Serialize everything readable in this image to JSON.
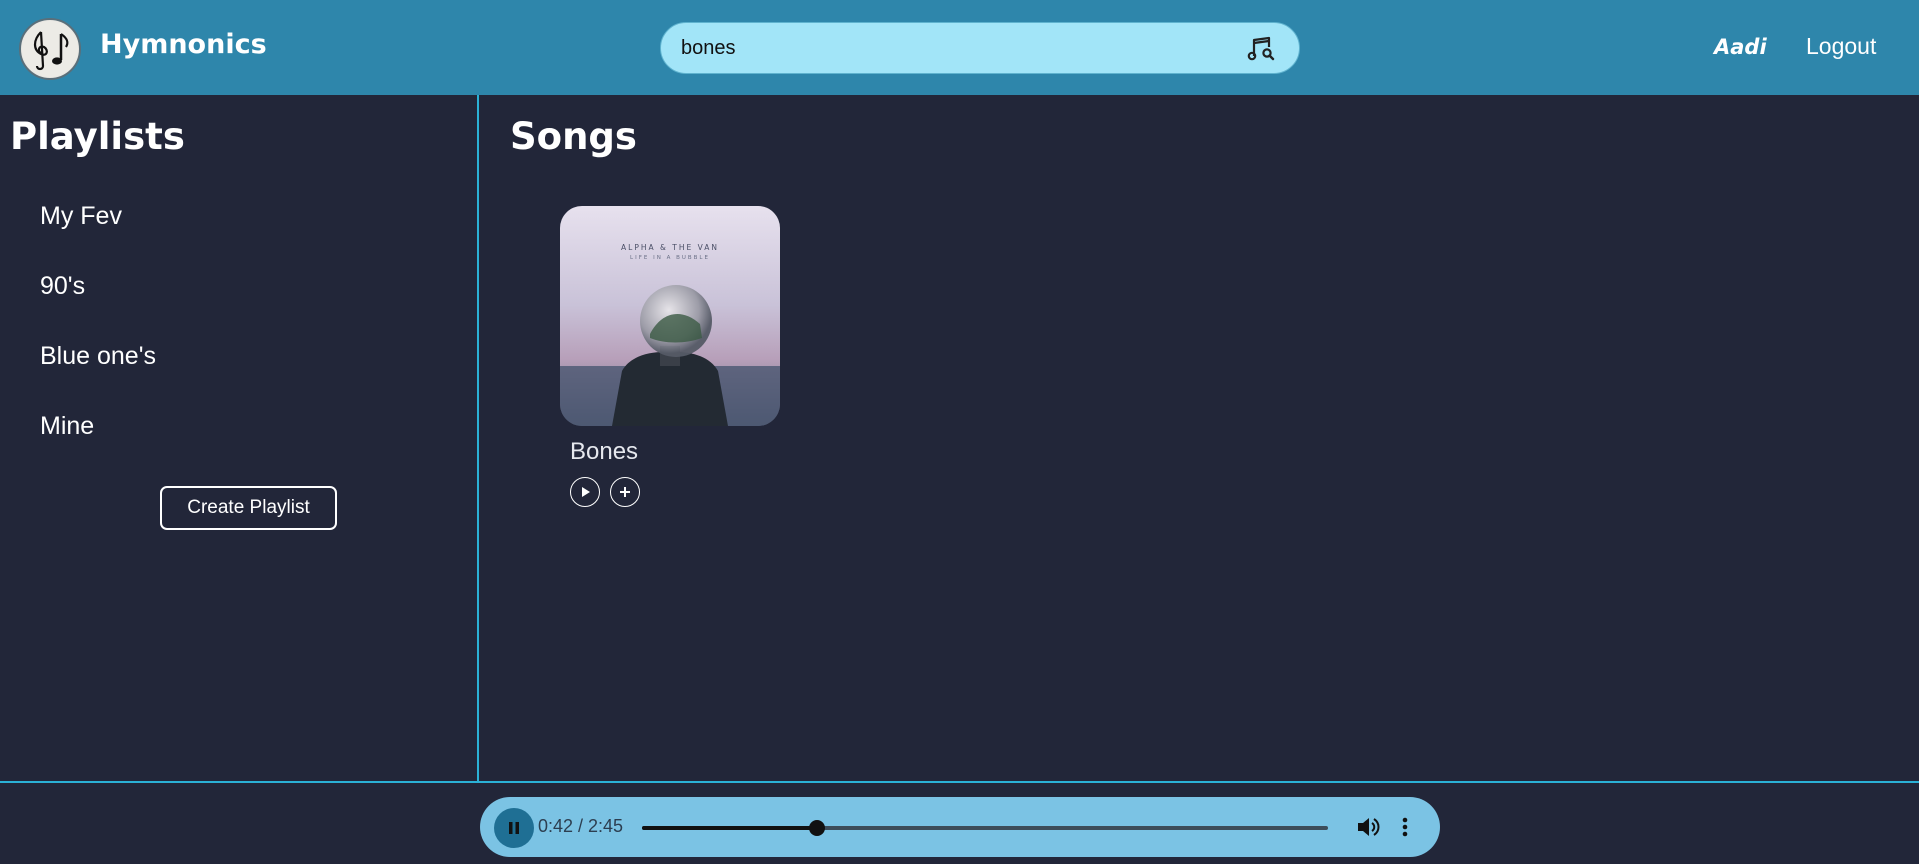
{
  "header": {
    "brand": "Hymnonics",
    "search_value": "bones",
    "search_icon": "music-search-icon",
    "user_name": "Aadi",
    "logout_label": "Logout"
  },
  "sidebar": {
    "title": "Playlists",
    "items": [
      {
        "label": "My Fev"
      },
      {
        "label": "90's"
      },
      {
        "label": "Blue one's"
      },
      {
        "label": "Mine"
      }
    ],
    "create_label": "Create Playlist"
  },
  "main": {
    "title": "Songs",
    "songs": [
      {
        "title": "Bones",
        "cover_text_top": "ALPHA & THE VAN",
        "cover_text_sub": "LIFE IN A BUBBLE"
      }
    ]
  },
  "player": {
    "time_display": "0:42 / 2:45",
    "progress_fraction": 0.255,
    "icons": [
      "pause-icon",
      "volume-icon",
      "more-vertical-icon"
    ]
  },
  "colors": {
    "header_bg": "#2e86ab",
    "body_bg": "#222639",
    "accent_line": "#2bb1d6",
    "search_bg": "#a2e5f8",
    "player_bg": "#7bc3e4"
  }
}
